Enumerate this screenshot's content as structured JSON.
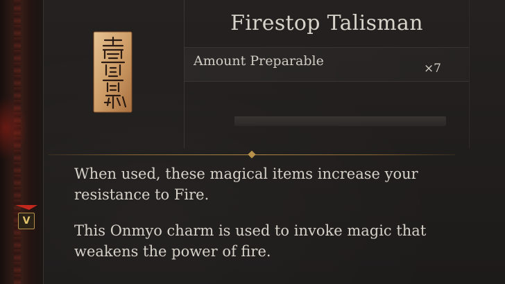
{
  "item": {
    "name": "Firestop Talisman",
    "icon": "talisman-icon",
    "stat": {
      "label": "Amount Preparable",
      "value": "×7"
    },
    "description": [
      "When used, these magical items increase your resistance to Fire.",
      "This Onmyo charm is used to invoke magic that weakens the power of fire."
    ]
  },
  "hud": {
    "badge_label": "V",
    "badge_icon": "red-arrow-marker-icon"
  },
  "colors": {
    "background": "#1e1c1b",
    "text": "#d6d2ca",
    "accent_gold": "#b8914a",
    "marker_red": "#c4281c"
  }
}
